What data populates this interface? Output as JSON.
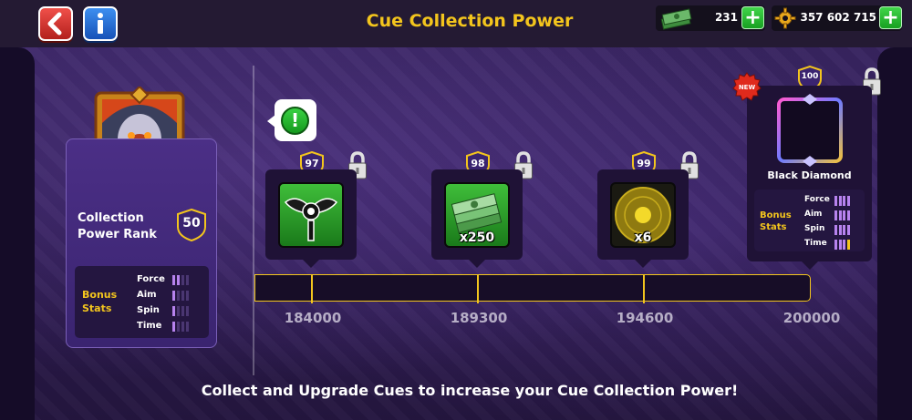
{
  "header": {
    "title": "Cue Collection Power"
  },
  "currency": {
    "cash": "231",
    "coins": "357 602 715"
  },
  "rank": {
    "label": "Collection Power Rank",
    "value": "50"
  },
  "bonus_stats": {
    "title": "Bonus Stats",
    "stats": [
      {
        "name": "Force",
        "level": 2,
        "max": 4
      },
      {
        "name": "Aim",
        "level": 1,
        "max": 4
      },
      {
        "name": "Spin",
        "level": 1,
        "max": 4
      },
      {
        "name": "Time",
        "level": 1,
        "max": 4
      }
    ]
  },
  "rewards": [
    {
      "level": "97",
      "item": "cue-piece",
      "quantity": "",
      "milestone": "184000"
    },
    {
      "level": "98",
      "item": "cash",
      "quantity": "x250",
      "milestone": "189300"
    },
    {
      "level": "99",
      "item": "spin-boost",
      "quantity": "x6",
      "milestone": "194600"
    }
  ],
  "final_reward": {
    "level": "100",
    "name": "Black Diamond",
    "badge": "NEW",
    "milestone": "200000",
    "bonus_title": "Bonus Stats",
    "stats": [
      {
        "name": "Force",
        "level": 4,
        "max": 4
      },
      {
        "name": "Aim",
        "level": 4,
        "max": 4
      },
      {
        "name": "Spin",
        "level": 4,
        "max": 4
      },
      {
        "name": "Time",
        "level": 3.5,
        "max": 4
      }
    ]
  },
  "progress": {
    "value": 0,
    "max": 200000
  },
  "footer": {
    "text": "Collect and Upgrade Cues to increase your Cue Collection Power!"
  },
  "colors": {
    "accent": "#f3c51d",
    "background": "#2c1b4f",
    "green": "#17a021"
  }
}
